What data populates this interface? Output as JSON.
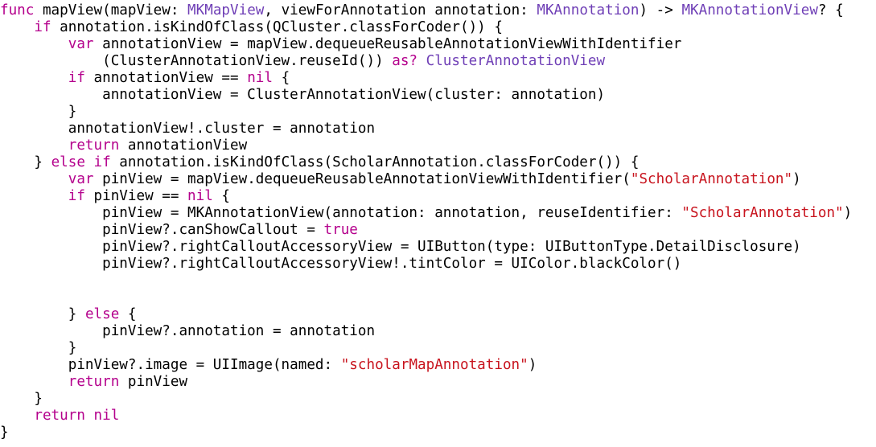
{
  "editor": {
    "language": "swift",
    "colors": {
      "background": "#ffffff",
      "plain": "#000000",
      "keyword": "#b4008c",
      "type": "#6f3fb6",
      "string": "#c8141e"
    },
    "lines": [
      [
        [
          "kw",
          "func"
        ],
        [
          "pl",
          " mapView(mapView: "
        ],
        [
          "ty",
          "MKMapView"
        ],
        [
          "pl",
          ", viewForAnnotation annotation: "
        ],
        [
          "ty",
          "MKAnnotation"
        ],
        [
          "pl",
          ") -> "
        ],
        [
          "ty",
          "MKAnnotationView"
        ],
        [
          "pl",
          "? {"
        ]
      ],
      [
        [
          "pl",
          "    "
        ],
        [
          "kw",
          "if"
        ],
        [
          "pl",
          " annotation.isKindOfClass(QCluster.classForCoder()) {"
        ]
      ],
      [
        [
          "pl",
          "        "
        ],
        [
          "kw",
          "var"
        ],
        [
          "pl",
          " annotationView = mapView.dequeueReusableAnnotationViewWithIdentifier"
        ]
      ],
      [
        [
          "pl",
          "            (ClusterAnnotationView.reuseId()) "
        ],
        [
          "kw",
          "as?"
        ],
        [
          "pl",
          " "
        ],
        [
          "ty",
          "ClusterAnnotationView"
        ]
      ],
      [
        [
          "pl",
          "        "
        ],
        [
          "kw",
          "if"
        ],
        [
          "pl",
          " annotationView == "
        ],
        [
          "kw",
          "nil"
        ],
        [
          "pl",
          " {"
        ]
      ],
      [
        [
          "pl",
          "            annotationView = ClusterAnnotationView(cluster: annotation)"
        ]
      ],
      [
        [
          "pl",
          "        }"
        ]
      ],
      [
        [
          "pl",
          "        annotationView!.cluster = annotation"
        ]
      ],
      [
        [
          "pl",
          "        "
        ],
        [
          "kw",
          "return"
        ],
        [
          "pl",
          " annotationView"
        ]
      ],
      [
        [
          "pl",
          "    } "
        ],
        [
          "kw",
          "else"
        ],
        [
          "pl",
          " "
        ],
        [
          "kw",
          "if"
        ],
        [
          "pl",
          " annotation.isKindOfClass(ScholarAnnotation.classForCoder()) {"
        ]
      ],
      [
        [
          "pl",
          "        "
        ],
        [
          "kw",
          "var"
        ],
        [
          "pl",
          " pinView = mapView.dequeueReusableAnnotationViewWithIdentifier("
        ],
        [
          "str",
          "\"ScholarAnnotation\""
        ],
        [
          "pl",
          ")"
        ]
      ],
      [
        [
          "pl",
          "        "
        ],
        [
          "kw",
          "if"
        ],
        [
          "pl",
          " pinView == "
        ],
        [
          "kw",
          "nil"
        ],
        [
          "pl",
          " {"
        ]
      ],
      [
        [
          "pl",
          "            pinView = MKAnnotationView(annotation: annotation, reuseIdentifier: "
        ],
        [
          "str",
          "\"ScholarAnnotation\""
        ],
        [
          "pl",
          ")"
        ]
      ],
      [
        [
          "pl",
          "            pinView?.canShowCallout = "
        ],
        [
          "kw",
          "true"
        ]
      ],
      [
        [
          "pl",
          "            pinView?.rightCalloutAccessoryView = UIButton(type: UIButtonType.DetailDisclosure)"
        ]
      ],
      [
        [
          "pl",
          "            pinView?.rightCalloutAccessoryView!.tintColor = UIColor.blackColor()"
        ]
      ],
      [],
      [],
      [
        [
          "pl",
          "        } "
        ],
        [
          "kw",
          "else"
        ],
        [
          "pl",
          " {"
        ]
      ],
      [
        [
          "pl",
          "            pinView?.annotation = annotation"
        ]
      ],
      [
        [
          "pl",
          "        }"
        ]
      ],
      [
        [
          "pl",
          "        pinView?.image = UIImage(named: "
        ],
        [
          "str",
          "\"scholarMapAnnotation\""
        ],
        [
          "pl",
          ")"
        ]
      ],
      [
        [
          "pl",
          "        "
        ],
        [
          "kw",
          "return"
        ],
        [
          "pl",
          " pinView"
        ]
      ],
      [
        [
          "pl",
          "    }"
        ]
      ],
      [
        [
          "pl",
          "    "
        ],
        [
          "kw",
          "return"
        ],
        [
          "pl",
          " "
        ],
        [
          "kw",
          "nil"
        ]
      ],
      [
        [
          "pl",
          "}"
        ]
      ]
    ]
  }
}
